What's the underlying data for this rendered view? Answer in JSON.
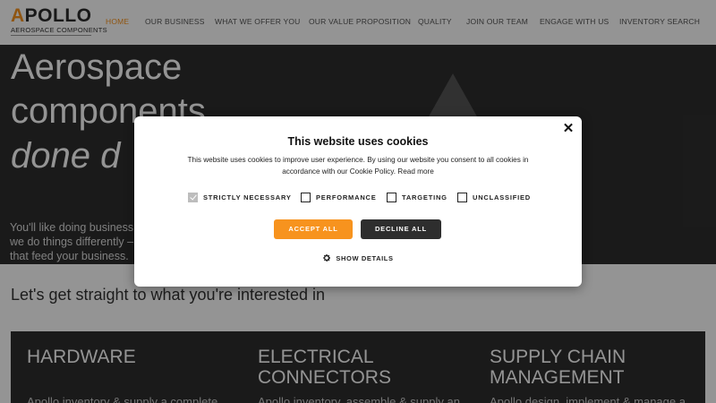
{
  "brand": {
    "name_first": "A",
    "name_rest": "POLLO",
    "subtitle": "AEROSPACE COMPONENTS"
  },
  "nav": {
    "items": [
      {
        "label": "HOME",
        "active": true
      },
      {
        "label": "OUR BUSINESS",
        "active": false
      },
      {
        "label": "WHAT WE OFFER YOU",
        "active": false
      },
      {
        "label": "OUR VALUE PROPOSITION",
        "active": false
      },
      {
        "label": "QUALITY",
        "active": false
      },
      {
        "label": "JOIN OUR TEAM",
        "active": false
      },
      {
        "label": "ENGAGE WITH US",
        "active": false
      },
      {
        "label": "INVENTORY SEARCH",
        "active": false
      }
    ]
  },
  "hero": {
    "line1": "Aerospace",
    "line2": "components",
    "line3": "done d",
    "para_line1": "You'll like doing business",
    "para_line2": "we do things differently –",
    "para_line3": "that feed your business."
  },
  "main": {
    "section_title": "Let's get straight to what you're interested in",
    "cards": [
      {
        "title_line1": "HARDWARE",
        "title_line2": "",
        "text": "Apollo inventory & supply a complete"
      },
      {
        "title_line1": "ELECTRICAL",
        "title_line2": "CONNECTORS",
        "text": "Apollo inventory, assemble & supply an"
      },
      {
        "title_line1": "SUPPLY CHAIN",
        "title_line2": "MANAGEMENT",
        "text": "Apollo design, implement & manage a"
      }
    ]
  },
  "cookie_modal": {
    "title": "This website uses cookies",
    "body": "This website uses cookies to improve user experience. By using our website you consent to all cookies in accordance with our Cookie Policy.",
    "read_more": "Read more",
    "close_symbol": "✕",
    "options": [
      {
        "label": "STRICTLY NECESSARY",
        "checked": true
      },
      {
        "label": "PERFORMANCE",
        "checked": false
      },
      {
        "label": "TARGETING",
        "checked": false
      },
      {
        "label": "UNCLASSIFIED",
        "checked": false
      }
    ],
    "accept_label": "ACCEPT ALL",
    "decline_label": "DECLINE ALL",
    "details_label": "SHOW DETAILS"
  },
  "colors": {
    "accent": "#f7931e",
    "dark": "#2e2e2e"
  }
}
